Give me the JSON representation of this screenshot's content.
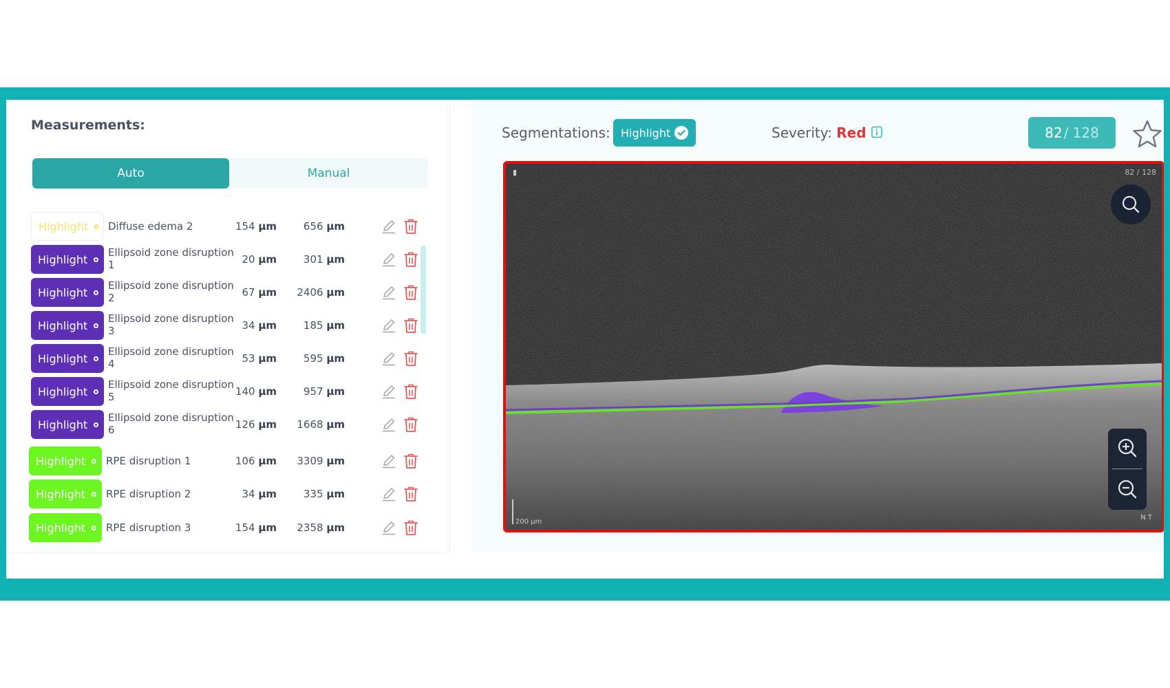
{
  "measurements": {
    "title": "Measurements:",
    "tabs": {
      "auto": "Auto",
      "manual": "Manual"
    },
    "rows": [
      {
        "highlight": "Highlight",
        "color": "yellow",
        "name": "Diffuse edema 2",
        "v1": "154",
        "v2": "656",
        "unit": "µm"
      },
      {
        "highlight": "Highlight",
        "color": "purple",
        "name": "Ellipsoid zone disruption 1",
        "v1": "20",
        "v2": "301",
        "unit": "µm"
      },
      {
        "highlight": "Highlight",
        "color": "purple",
        "name": "Ellipsoid zone disruption 2",
        "v1": "67",
        "v2": "2406",
        "unit": "µm"
      },
      {
        "highlight": "Highlight",
        "color": "purple",
        "name": "Ellipsoid zone disruption 3",
        "v1": "34",
        "v2": "185",
        "unit": "µm"
      },
      {
        "highlight": "Highlight",
        "color": "purple",
        "name": "Ellipsoid zone disruption 4",
        "v1": "53",
        "v2": "595",
        "unit": "µm"
      },
      {
        "highlight": "Highlight",
        "color": "purple",
        "name": "Ellipsoid zone disruption 5",
        "v1": "140",
        "v2": "957",
        "unit": "µm"
      },
      {
        "highlight": "Highlight",
        "color": "purple",
        "name": "Ellipsoid zone disruption 6",
        "v1": "126",
        "v2": "1668",
        "unit": "µm"
      },
      {
        "highlight": "Highlight",
        "color": "green",
        "name": "RPE disruption 1",
        "v1": "106",
        "v2": "3309",
        "unit": "µm"
      },
      {
        "highlight": "Highlight",
        "color": "green",
        "name": "RPE disruption 2",
        "v1": "34",
        "v2": "335",
        "unit": "µm"
      },
      {
        "highlight": "Highlight",
        "color": "green",
        "name": "RPE disruption 3",
        "v1": "154",
        "v2": "2358",
        "unit": "µm"
      }
    ]
  },
  "viewer": {
    "segmentations_label": "Segmentations:",
    "segmentations_badge": "Highlight",
    "severity_label": "Severity:",
    "severity_value": "Red",
    "slice_current": "82",
    "slice_total": "/ 128",
    "image_counter": "82 / 128",
    "scale_label": "200 µm",
    "orientation_label": "N      T",
    "colors": {
      "accent": "#2aa7a5",
      "severity": "#e0363a",
      "yellow": "#f3e46a",
      "purple": "#5d2fb4",
      "green": "#6cf521"
    }
  }
}
